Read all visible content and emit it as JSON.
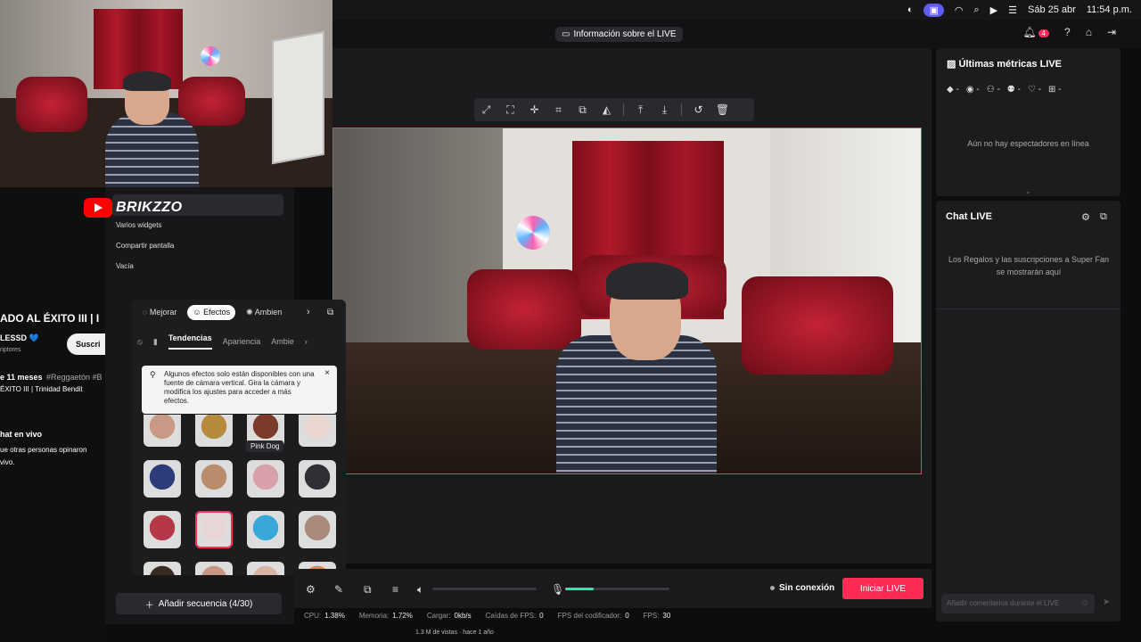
{
  "menubar": {
    "date": "Sáb 25 abr",
    "time": "11:54 p.m.",
    "icons": [
      "disk-icon",
      "screen-record-icon",
      "wifi-icon",
      "search-icon",
      "play-icon",
      "control-center-icon"
    ]
  },
  "topbar": {
    "info_label": "Información sobre el LIVE",
    "notification_count": "4"
  },
  "overlay": {
    "brand": "BRIKZZO"
  },
  "scenes": {
    "items": [
      "Varios widgets",
      "Compartir pantalla",
      "Vacía"
    ],
    "add_sequence": "Añadir secuencia (4/30)"
  },
  "youtube": {
    "title_partial": "ADO AL ÉXITO III | I",
    "channel_partial": "LESSD 💙",
    "subscribers_partial": "riptores",
    "subscribe_partial": "Suscri",
    "meta_partial": "e 11 meses",
    "hashtag_partial": "#Reggaetón #B",
    "desc_partial": "ÉXITO III |  Trinidad Bendit",
    "chat_title_partial": "hat en vivo",
    "chat_line1": "ue otras personas opinaron",
    "chat_line2": "vivo.",
    "views_bottom": "1.3 M de vistas · hace 1 año"
  },
  "effects": {
    "tabs": [
      "Mejorar",
      "Efectos",
      "Ambien"
    ],
    "active_tab": "Efectos",
    "sub_tabs": [
      "Tendencias",
      "Apariencia",
      "Ambie"
    ],
    "notice": "Algunos efectos solo están disponibles con una fuente de cámara vertical. Gira la cámara y modifica los ajustes para acceder a más efectos.",
    "tooltip": "Pink Dog",
    "thumbs": [
      {
        "color": "#c89a86"
      },
      {
        "color": "#b58a3c"
      },
      {
        "color": "#7a3b2a"
      },
      {
        "color": "#e9d7d0"
      },
      {
        "color": "#2d3b7a"
      },
      {
        "color": "#b98c6c"
      },
      {
        "color": "#d8a0a8"
      },
      {
        "color": "#2f2f35"
      },
      {
        "color": "#b43848"
      },
      {
        "color": "#e8d6d6"
      },
      {
        "color": "#38a8d8"
      },
      {
        "color": "#a98a7c"
      },
      {
        "color": "#3a2a24"
      },
      {
        "color": "#c89682"
      },
      {
        "color": "#d8b5a2"
      },
      {
        "color": "#f08038"
      }
    ]
  },
  "metrics": {
    "title": "Últimas métricas LIVE",
    "items": [
      "-",
      "-",
      "-",
      "-",
      "-",
      "-"
    ],
    "empty": "Aún no hay espectadores en línea"
  },
  "chat": {
    "title": "Chat LIVE",
    "message": "Los Regalos y las suscripciones a Super Fan se mostrarán aquí",
    "input_placeholder": "Añadir comentarios durante el LIVE"
  },
  "controls": {
    "volume_level": 0,
    "mic_level": 0.27,
    "status": "Sin conexión",
    "go_live": "Iniciar LIVE"
  },
  "stats": [
    {
      "label": "CPU:",
      "value": "1.38%"
    },
    {
      "label": "Memoria:",
      "value": "1.72%"
    },
    {
      "label": "Cargar:",
      "value": "0kb/s"
    },
    {
      "label": "Caídas de FPS:",
      "value": "0"
    },
    {
      "label": "FPS del codificador:",
      "value": "0"
    },
    {
      "label": "FPS:",
      "value": "30"
    }
  ],
  "colors": {
    "accent": "#fe2c55",
    "mic_fill": "#2ee6b0"
  }
}
